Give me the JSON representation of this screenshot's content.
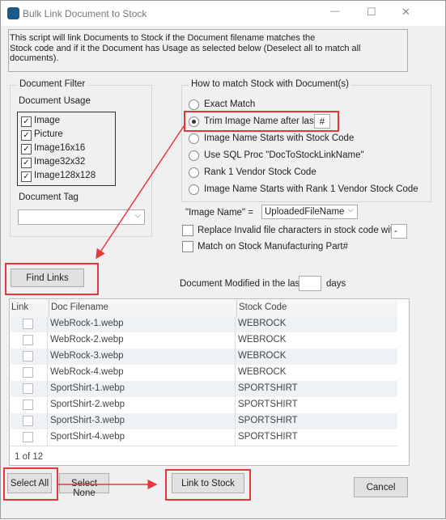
{
  "window": {
    "title": "Bulk Link Document to Stock",
    "minimize": "—",
    "maximize": "☐",
    "close": "✕"
  },
  "description": {
    "line1": "This script will link Documents to Stock if the Document filename matches the",
    "line2": "Stock code and if it the Document has Usage as selected below (Deselect all to match all documents)."
  },
  "filter": {
    "title": "Document Filter",
    "usage_label": "Document Usage",
    "usages": [
      {
        "label": "Image",
        "checked": true
      },
      {
        "label": "Picture",
        "checked": true
      },
      {
        "label": "Image16x16",
        "checked": true
      },
      {
        "label": "Image32x32",
        "checked": true
      },
      {
        "label": "Image128x128",
        "checked": true
      }
    ],
    "tag_label": "Document Tag",
    "tag_value": ""
  },
  "match": {
    "title": "How to match Stock with Document(s)",
    "options": [
      "Exact Match",
      "Trim Image Name after last",
      "Image Name Starts with Stock Code",
      "Use SQL Proc \"DocToStockLinkName\"",
      "Rank 1 Vendor Stock Code",
      "Image Name Starts with Rank 1 Vendor Stock Code"
    ],
    "selected": 1,
    "trim_char": "#"
  },
  "image_name": {
    "label": "\"Image Name\" =",
    "value": "UploadedFileName"
  },
  "replace": {
    "label": "Replace Invalid file characters in stock code with",
    "checked": false,
    "value": "-"
  },
  "match_mfg": {
    "label": "Match on Stock Manufacturing Part#",
    "checked": false
  },
  "find_links": "Find Links",
  "modified": {
    "label": "Document Modified in the last",
    "value": "",
    "suffix": "days"
  },
  "grid": {
    "headers": [
      "Link",
      "Doc Filename",
      "Stock Code"
    ],
    "rows": [
      {
        "file": "WebRock-1.webp",
        "code": "WEBROCK"
      },
      {
        "file": "WebRock-2.webp",
        "code": "WEBROCK"
      },
      {
        "file": "WebRock-3.webp",
        "code": "WEBROCK"
      },
      {
        "file": "WebRock-4.webp",
        "code": "WEBROCK"
      },
      {
        "file": "SportShirt-1.webp",
        "code": "SPORTSHIRT"
      },
      {
        "file": "SportShirt-2.webp",
        "code": "SPORTSHIRT"
      },
      {
        "file": "SportShirt-3.webp",
        "code": "SPORTSHIRT"
      },
      {
        "file": "SportShirt-4.webp",
        "code": "SPORTSHIRT"
      }
    ],
    "pager": "1 of 12"
  },
  "buttons": {
    "select_all": "Select All",
    "select_none": "Select None",
    "link": "Link to Stock",
    "cancel": "Cancel"
  },
  "colors": {
    "highlight": "#e8373b"
  }
}
